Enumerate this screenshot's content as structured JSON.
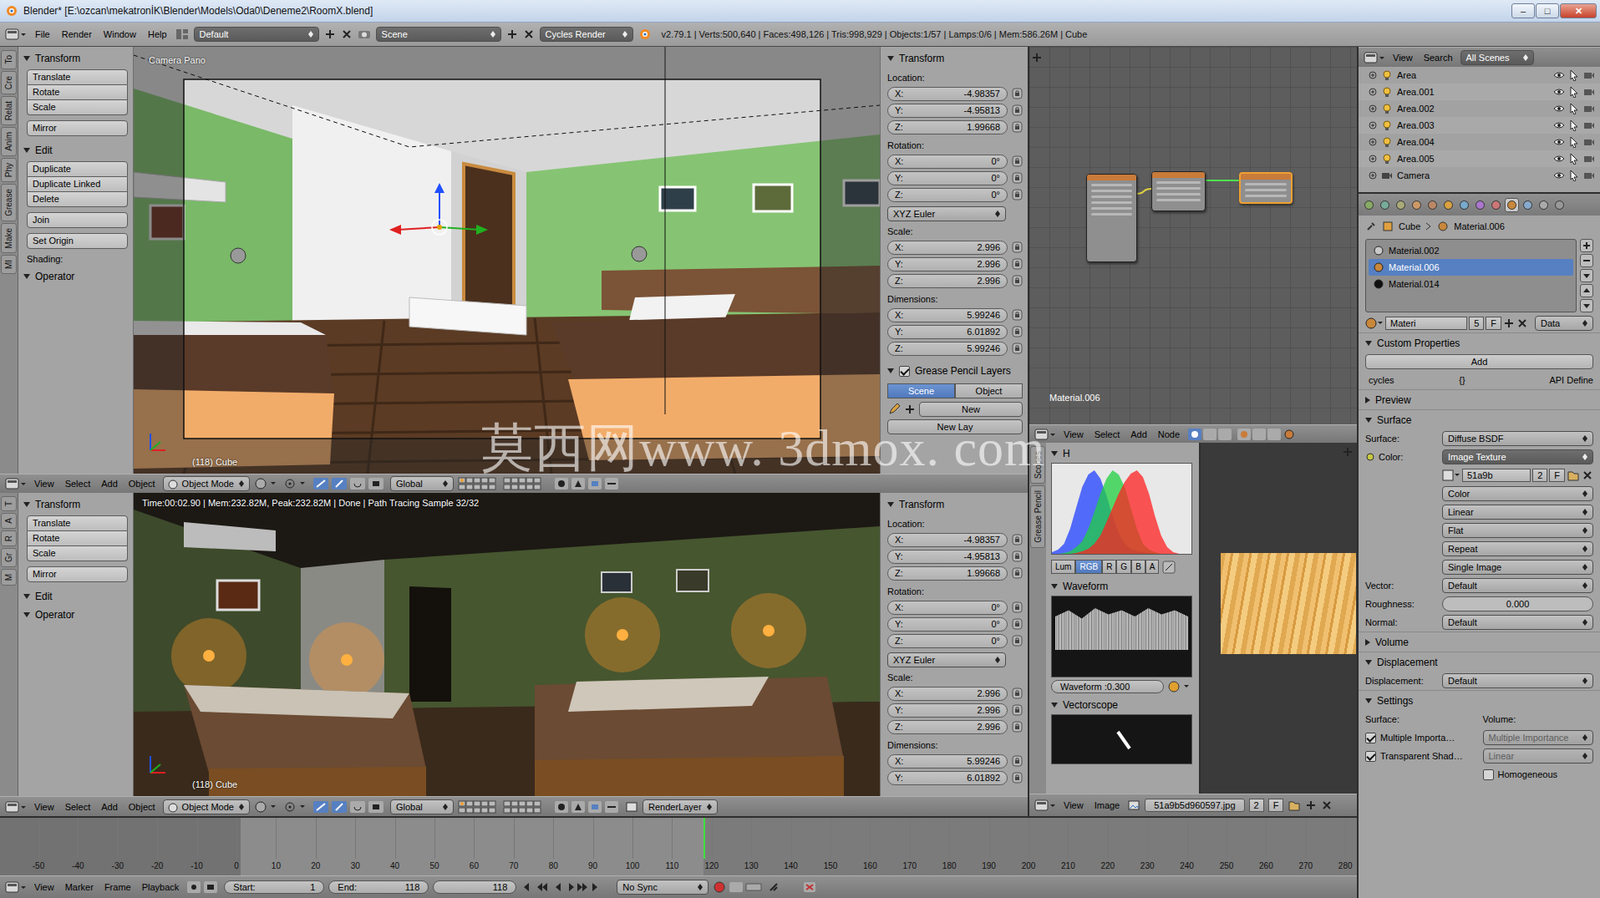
{
  "window": {
    "title": "Blender* [E:\\ozcan\\mekatronİK\\Blender\\Models\\Oda0\\Deneme2\\RoomX.blend]",
    "controls": [
      "–",
      "□",
      "✕"
    ]
  },
  "info_header": {
    "menus": [
      "File",
      "Render",
      "Window",
      "Help"
    ],
    "layout": "Default",
    "scene": "Scene",
    "engine": "Cycles Render",
    "stats": "v2.79.1 | Verts:500,640 | Faces:498,126 | Tris:998,929 | Objects:1/57 | Lamps:0/6 | Mem:586.26M | Cube"
  },
  "viewport_top": {
    "tabs": [
      "To",
      "Cre",
      "Relat",
      "Anim",
      "Phy",
      "Grease",
      "Make",
      "MI"
    ],
    "tool_panels": [
      {
        "title": "Transform",
        "expanded": true,
        "groups": [
          [
            "Translate",
            "Rotate",
            "Scale"
          ],
          [
            "Mirror"
          ]
        ]
      },
      {
        "title": "Edit",
        "expanded": true,
        "groups": [
          [
            "Duplicate",
            "Duplicate Linked",
            "Delete"
          ],
          [
            "Join"
          ],
          [
            "Set Origin"
          ]
        ],
        "note": "Shading:"
      },
      {
        "title": "Operator",
        "expanded": true,
        "groups": []
      }
    ],
    "camera_label": "Camera Pano",
    "object_label": "(118) Cube",
    "n_panel": {
      "title": "Transform",
      "expanded": true,
      "rows": [
        {
          "kind": "label",
          "text": "Location:"
        },
        {
          "kind": "field",
          "axis": "X:",
          "value": "-4.98357"
        },
        {
          "kind": "field",
          "axis": "Y:",
          "value": "-4.95813"
        },
        {
          "kind": "field",
          "axis": "Z:",
          "value": "1.99668"
        },
        {
          "kind": "label",
          "text": "Rotation:"
        },
        {
          "kind": "field",
          "axis": "X:",
          "value": "0°"
        },
        {
          "kind": "field",
          "axis": "Y:",
          "value": "0°"
        },
        {
          "kind": "field",
          "axis": "Z:",
          "value": "0°"
        },
        {
          "kind": "dropdown",
          "text": "XYZ Euler"
        },
        {
          "kind": "label",
          "text": "Scale:"
        },
        {
          "kind": "field",
          "axis": "X:",
          "value": "2.996"
        },
        {
          "kind": "field",
          "axis": "Y:",
          "value": "2.996"
        },
        {
          "kind": "field",
          "axis": "Z:",
          "value": "2.996"
        },
        {
          "kind": "label",
          "text": "Dimensions:"
        },
        {
          "kind": "field",
          "axis": "X:",
          "value": "5.99246"
        },
        {
          "kind": "field",
          "axis": "Y:",
          "value": "6.01892"
        },
        {
          "kind": "field",
          "axis": "Z:",
          "value": "5.99246"
        }
      ]
    },
    "grease_pencil": {
      "title": "Grease Pencil Layers",
      "expanded": true,
      "enabled": true,
      "tabs": [
        {
          "label": "Scene",
          "selected": true
        },
        {
          "label": "Object",
          "selected": false
        }
      ],
      "new": "New",
      "new_layer": "New Lay"
    },
    "header": {
      "menus": [
        "View",
        "Select",
        "Add",
        "Object"
      ],
      "mode": "Object Mode",
      "orientation": "Global"
    }
  },
  "viewport_bottom": {
    "tabs": [
      "T",
      "A",
      "R",
      "Gr",
      "M"
    ],
    "tool_panels": [
      {
        "title": "Transform",
        "expanded": true,
        "groups": [
          [
            "Translate",
            "Rotate",
            "Scale"
          ],
          [
            "Mirror"
          ]
        ]
      },
      {
        "title": "Edit",
        "expanded": true,
        "groups": []
      },
      {
        "title": "Operator",
        "expanded": true,
        "groups": []
      }
    ],
    "render_info": "Time:00:02.90 | Mem:232.82M, Peak:232.82M | Done | Path Tracing Sample 32/32",
    "object_label": "(118) Cube",
    "n_panel": {
      "title": "Transform",
      "expanded": true,
      "rows": [
        {
          "kind": "label",
          "text": "Location:"
        },
        {
          "kind": "field",
          "axis": "X:",
          "value": "-4.98357"
        },
        {
          "kind": "field",
          "axis": "Y:",
          "value": "-4.95813"
        },
        {
          "kind": "field",
          "axis": "Z:",
          "value": "1.99668"
        },
        {
          "kind": "label",
          "text": "Rotation:"
        },
        {
          "kind": "field",
          "axis": "X:",
          "value": "0°"
        },
        {
          "kind": "field",
          "axis": "Y:",
          "value": "0°"
        },
        {
          "kind": "field",
          "axis": "Z:",
          "value": "0°"
        },
        {
          "kind": "dropdown",
          "text": "XYZ Euler"
        },
        {
          "kind": "label",
          "text": "Scale:"
        },
        {
          "kind": "field",
          "axis": "X:",
          "value": "2.996"
        },
        {
          "kind": "field",
          "axis": "Y:",
          "value": "2.996"
        },
        {
          "kind": "field",
          "axis": "Z:",
          "value": "2.996"
        },
        {
          "kind": "label",
          "text": "Dimensions:"
        },
        {
          "kind": "field",
          "axis": "X:",
          "value": "5.99246"
        },
        {
          "kind": "field",
          "axis": "Y:",
          "value": "6.01892"
        }
      ]
    },
    "header": {
      "menus": [
        "View",
        "Select",
        "Add",
        "Object"
      ],
      "mode": "Object Mode",
      "orientation": "Global",
      "render_layer": "RenderLayer"
    }
  },
  "node_editor": {
    "material_label": "Material.006",
    "header": {
      "menus": [
        "View",
        "Select",
        "Add",
        "Node"
      ]
    }
  },
  "scopes": {
    "tabs": [
      "Scopes",
      "Grease Pencil"
    ],
    "histogram": {
      "title": "H",
      "expanded": true,
      "series": [
        {
          "name": "B",
          "color": "#2040ff",
          "values": [
            0.02,
            0.05,
            0.12,
            0.3,
            0.55,
            0.8,
            0.95,
            1,
            0.9,
            0.7,
            0.45,
            0.25,
            0.12,
            0.06,
            0.03,
            0.02,
            0.01,
            0,
            0,
            0,
            0,
            0,
            0,
            0
          ]
        },
        {
          "name": "G",
          "color": "#20d040",
          "values": [
            0,
            0,
            0.01,
            0.03,
            0.08,
            0.15,
            0.3,
            0.5,
            0.72,
            0.9,
            1,
            0.95,
            0.8,
            0.55,
            0.3,
            0.12,
            0.05,
            0.02,
            0,
            0,
            0,
            0,
            0,
            0
          ]
        },
        {
          "name": "R",
          "color": "#ff2020",
          "values": [
            0,
            0,
            0,
            0,
            0.01,
            0.03,
            0.06,
            0.12,
            0.22,
            0.38,
            0.55,
            0.72,
            0.86,
            0.96,
            1,
            0.92,
            0.72,
            0.45,
            0.22,
            0.08,
            0.02,
            0,
            0,
            0
          ]
        }
      ],
      "channels": [
        {
          "label": "Lum",
          "selected": false
        },
        {
          "label": "RGB",
          "selected": true
        },
        {
          "label": "R",
          "selected": false
        },
        {
          "label": "G",
          "selected": false
        },
        {
          "label": "B",
          "selected": false
        },
        {
          "label": "A",
          "selected": false
        }
      ]
    },
    "waveform": {
      "title": "Waveform",
      "expanded": true,
      "opacity": "Waveform :0.300"
    },
    "vectorscope": {
      "title": "Vectorscope",
      "expanded": true
    }
  },
  "image_editor": {
    "header": {
      "menus": [
        "View",
        "Image"
      ],
      "image": "51a9b5d960597.jpg",
      "users": "2",
      "fake": "F"
    }
  },
  "outliner": {
    "header": {
      "menus": [
        "View",
        "Search"
      ],
      "filter": "All Scenes"
    },
    "items": [
      {
        "name": "Area",
        "kind": "lamp"
      },
      {
        "name": "Area.001",
        "kind": "lamp"
      },
      {
        "name": "Area.002",
        "kind": "lamp"
      },
      {
        "name": "Area.003",
        "kind": "lamp"
      },
      {
        "name": "Area.004",
        "kind": "lamp"
      },
      {
        "name": "Area.005",
        "kind": "lamp"
      },
      {
        "name": "Camera",
        "kind": "camera"
      }
    ]
  },
  "properties": {
    "tabs": [
      {
        "selected": false
      },
      {
        "selected": false
      },
      {
        "selected": false
      },
      {
        "selected": false
      },
      {
        "selected": false
      },
      {
        "selected": false
      },
      {
        "selected": false
      },
      {
        "selected": false
      },
      {
        "selected": false
      },
      {
        "selected": true
      },
      {
        "selected": false
      },
      {
        "selected": false
      },
      {
        "selected": false
      }
    ],
    "breadcrumb": [
      "Cube",
      "Material.006"
    ],
    "slots": [
      {
        "name": "Material.002",
        "color": "#c8c8c8",
        "selected": false
      },
      {
        "name": "Material.006",
        "color": "#c8873a",
        "selected": true
      },
      {
        "name": "Material.014",
        "color": "#111111",
        "selected": false
      }
    ],
    "datablock": {
      "name": "Materi",
      "users": "5",
      "fake": "F",
      "link": "Data"
    },
    "custom_properties": {
      "title": "Custom Properties",
      "expanded": true,
      "add": "Add",
      "prop": "cycles",
      "value": "{}",
      "button": "API Define"
    },
    "preview": {
      "title": "Preview",
      "expanded": false
    },
    "surface": {
      "title": "Surface",
      "expanded": true,
      "rows": [
        {
          "kind": "dropdown",
          "label": "Surface:",
          "value": "Diffuse BSDF"
        },
        {
          "kind": "link",
          "label": "Color:",
          "value": "Image Texture"
        },
        {
          "kind": "image",
          "name": "51a9b",
          "users": "2",
          "fake": "F"
        },
        {
          "kind": "dropdown",
          "value": "Color"
        },
        {
          "kind": "dropdown",
          "value": "Linear"
        },
        {
          "kind": "dropdown",
          "value": "Flat"
        },
        {
          "kind": "dropdown",
          "value": "Repeat"
        },
        {
          "kind": "dropdown",
          "value": "Single Image"
        },
        {
          "kind": "dropdown",
          "label": "Vector:",
          "value": "Default"
        },
        {
          "kind": "slider",
          "label": "Roughness:",
          "value": "0.000",
          "level": 0
        },
        {
          "kind": "dropdown",
          "label": "Normal:",
          "value": "Default"
        }
      ]
    },
    "volume": {
      "title": "Volume",
      "expanded": false
    },
    "displacement": {
      "title": "Displacement",
      "expanded": true,
      "rows": [
        {
          "kind": "dropdown",
          "label": "Displacement:",
          "value": "Default"
        }
      ]
    },
    "settings": {
      "title": "Settings",
      "expanded": true,
      "surface_label": "Surface:",
      "volume_label": "Volume:",
      "surface_checks": [
        {
          "label": "Multiple Importa…",
          "checked": true
        },
        {
          "label": "Transparent Shad…",
          "checked": true
        }
      ],
      "volume_options": [
        {
          "value": "Multiple Importance",
          "disabled": true
        },
        {
          "value": "Linear",
          "disabled": true
        }
      ],
      "homogeneous": {
        "label": "Homogeneous",
        "checked": false
      }
    }
  },
  "timeline": {
    "ticks": [
      "-50",
      "-40",
      "-30",
      "-20",
      "-10",
      "0",
      "10",
      "20",
      "30",
      "40",
      "50",
      "60",
      "70",
      "80",
      "90",
      "100",
      "110",
      "120",
      "130",
      "140",
      "150",
      "160",
      "170",
      "180",
      "190",
      "200",
      "210",
      "220",
      "230",
      "240",
      "250",
      "260",
      "270",
      "280"
    ],
    "header": {
      "menus": [
        "View",
        "Marker",
        "Frame",
        "Playback"
      ],
      "start_label": "Start:",
      "start_value": "1",
      "end_label": "End:",
      "end_value": "118",
      "frame": "118",
      "sync": "No Sync"
    }
  },
  "watermark": "莫西网www. 3dmox. com"
}
